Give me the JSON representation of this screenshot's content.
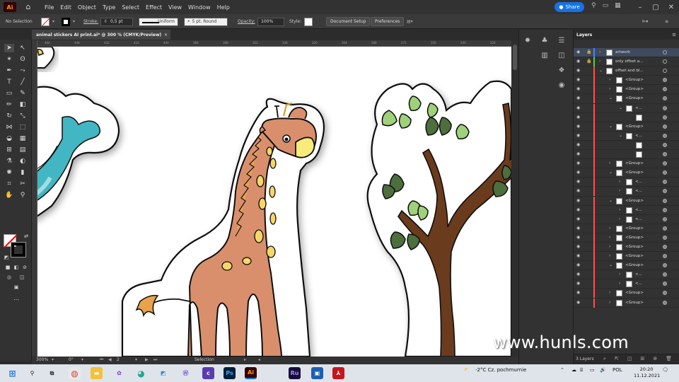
{
  "menubar": {
    "logo": "Ai",
    "menus": [
      "File",
      "Edit",
      "Object",
      "Type",
      "Select",
      "Effect",
      "View",
      "Window",
      "Help"
    ],
    "share_label": "Share"
  },
  "controlbar": {
    "selection_label": "No Selection",
    "stroke_label": "Stroke:",
    "stroke_value": "0,5 pt",
    "profile_label": "Uniform",
    "brush_label": "5 pt. Round",
    "opacity_label": "Opacity:",
    "opacity_value": "100%",
    "style_label": "Style:",
    "doc_setup_label": "Document Setup",
    "preferences_label": "Preferences"
  },
  "document": {
    "tab_title": "animal stickers AI print.ai* @ 300 % (CMYK/Preview)",
    "ruler_ticks": [
      "464",
      "448",
      "432",
      "416",
      "400",
      "384",
      "368",
      "352",
      "336",
      "320",
      "304",
      "288",
      "272",
      "256",
      "240",
      "224",
      "208"
    ]
  },
  "statusbar": {
    "zoom": "300%",
    "rotation": "0°",
    "artboard": "2",
    "tool": "Selection"
  },
  "layers": {
    "panel_title": "Layers",
    "footer_count": "3 Layers",
    "rows": [
      {
        "name": "artwork",
        "indent": 0,
        "expanded": false,
        "locked": true,
        "color": "#4f7fff",
        "selected": true
      },
      {
        "name": "only offset a...",
        "indent": 0,
        "expanded": false,
        "locked": true,
        "color": "#4fcf4f",
        "selected": false
      },
      {
        "name": "offset and bl...",
        "indent": 0,
        "expanded": true,
        "locked": false,
        "color": "#ff4f4f",
        "selected": false
      },
      {
        "name": "<Group>",
        "indent": 1,
        "expanded": false,
        "locked": false,
        "color": "#ff4f4f",
        "selected": false
      },
      {
        "name": "<Group>",
        "indent": 1,
        "expanded": false,
        "locked": false,
        "color": "#ff4f4f",
        "selected": false
      },
      {
        "name": "<Group>",
        "indent": 1,
        "expanded": true,
        "locked": false,
        "color": "#ff4f4f",
        "selected": false
      },
      {
        "name": "<...",
        "indent": 2,
        "expanded": true,
        "locked": false,
        "color": "#ff4f4f",
        "selected": false
      },
      {
        "name": "",
        "indent": 3,
        "expanded": false,
        "locked": false,
        "color": "#ff4f4f",
        "selected": false
      },
      {
        "name": "<Group>",
        "indent": 1,
        "expanded": true,
        "locked": false,
        "color": "#ff4f4f",
        "selected": false
      },
      {
        "name": "<...",
        "indent": 2,
        "expanded": true,
        "locked": false,
        "color": "#ff4f4f",
        "selected": false
      },
      {
        "name": "",
        "indent": 3,
        "expanded": false,
        "locked": false,
        "color": "#ff4f4f",
        "selected": false
      },
      {
        "name": "",
        "indent": 3,
        "expanded": false,
        "locked": false,
        "color": "#ff4f4f",
        "selected": false
      },
      {
        "name": "<Group>",
        "indent": 1,
        "expanded": false,
        "locked": false,
        "color": "#ff4f4f",
        "selected": false
      },
      {
        "name": "<Group>",
        "indent": 1,
        "expanded": true,
        "locked": false,
        "color": "#ff4f4f",
        "selected": false
      },
      {
        "name": "<...",
        "indent": 2,
        "expanded": false,
        "locked": false,
        "color": "#ff4f4f",
        "selected": false
      },
      {
        "name": "<...",
        "indent": 2,
        "expanded": false,
        "locked": false,
        "color": "#ff4f4f",
        "selected": false
      },
      {
        "name": "<Group>",
        "indent": 1,
        "expanded": true,
        "locked": false,
        "color": "#ff4f4f",
        "selected": false
      },
      {
        "name": "<...",
        "indent": 2,
        "expanded": false,
        "locked": false,
        "color": "#ff4f4f",
        "selected": false
      },
      {
        "name": "<...",
        "indent": 2,
        "expanded": false,
        "locked": false,
        "color": "#ff4f4f",
        "selected": false
      },
      {
        "name": "<Group>",
        "indent": 1,
        "expanded": false,
        "locked": false,
        "color": "#ff4f4f",
        "selected": false
      },
      {
        "name": "<Group>",
        "indent": 1,
        "expanded": false,
        "locked": false,
        "color": "#ff4f4f",
        "selected": false
      },
      {
        "name": "<Group>",
        "indent": 1,
        "expanded": false,
        "locked": false,
        "color": "#ff4f4f",
        "selected": false
      },
      {
        "name": "<Group>",
        "indent": 1,
        "expanded": false,
        "locked": false,
        "color": "#ff4f4f",
        "selected": false
      },
      {
        "name": "<Group>",
        "indent": 1,
        "expanded": true,
        "locked": false,
        "color": "#ff4f4f",
        "selected": false
      },
      {
        "name": "<...",
        "indent": 2,
        "expanded": false,
        "locked": false,
        "color": "#ff4f4f",
        "selected": false
      },
      {
        "name": "<...",
        "indent": 2,
        "expanded": false,
        "locked": false,
        "color": "#ff4f4f",
        "selected": false
      },
      {
        "name": "<Group>",
        "indent": 1,
        "expanded": false,
        "locked": false,
        "color": "#ff4f4f",
        "selected": false
      },
      {
        "name": "<Group>",
        "indent": 1,
        "expanded": false,
        "locked": false,
        "color": "#ff4f4f",
        "selected": false
      }
    ]
  },
  "watermark": "www.hunls.com",
  "taskbar": {
    "weather": "-2°C  Cz. pochmurnie",
    "lang": "POL",
    "time": "20:20",
    "date": "11.12.2021",
    "apps": [
      "windows-start",
      "search",
      "task-view",
      "chrome",
      "file-explorer",
      "photos",
      "edge",
      "files",
      "teams",
      "capture",
      "photoshop",
      "illustrator",
      "bridge",
      "media",
      "acrobat"
    ]
  },
  "colors": {
    "giraffe_body": "#d98f6c",
    "giraffe_spots": "#f5d66a",
    "snout": "#f7ec7a",
    "whale": "#43b6c2",
    "trunk": "#6b3a1e",
    "leaf_dark": "#4d6e3c",
    "leaf_light": "#9fd17a",
    "accent_share": "#1473e6"
  }
}
